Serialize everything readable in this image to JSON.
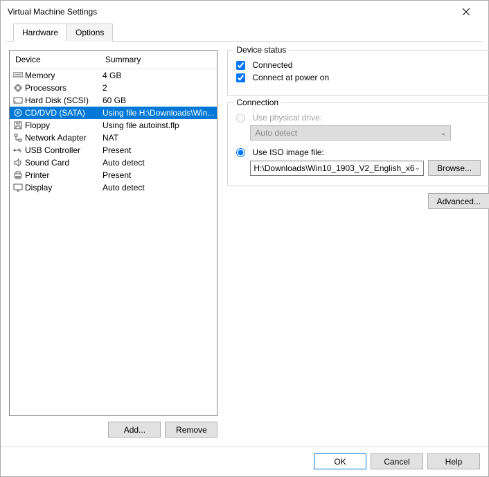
{
  "window": {
    "title": "Virtual Machine Settings"
  },
  "tabs": {
    "hardware": "Hardware",
    "options": "Options"
  },
  "headers": {
    "device": "Device",
    "summary": "Summary"
  },
  "devices": [
    {
      "name": "Memory",
      "summary": "4 GB"
    },
    {
      "name": "Processors",
      "summary": "2"
    },
    {
      "name": "Hard Disk (SCSI)",
      "summary": "60 GB"
    },
    {
      "name": "CD/DVD (SATA)",
      "summary": "Using file H:\\Downloads\\Win..."
    },
    {
      "name": "Floppy",
      "summary": "Using file autoinst.flp"
    },
    {
      "name": "Network Adapter",
      "summary": "NAT"
    },
    {
      "name": "USB Controller",
      "summary": "Present"
    },
    {
      "name": "Sound Card",
      "summary": "Auto detect"
    },
    {
      "name": "Printer",
      "summary": "Present"
    },
    {
      "name": "Display",
      "summary": "Auto detect"
    }
  ],
  "left_buttons": {
    "add": "Add...",
    "remove": "Remove"
  },
  "device_status": {
    "title": "Device status",
    "connected": "Connected",
    "connect_at_power_on": "Connect at power on"
  },
  "connection": {
    "title": "Connection",
    "use_physical_drive": "Use physical drive:",
    "auto_detect": "Auto detect",
    "use_iso": "Use ISO image file:",
    "iso_path": "H:\\Downloads\\Win10_1903_V2_English_x6",
    "browse": "Browse..."
  },
  "advanced": "Advanced...",
  "footer": {
    "ok": "OK",
    "cancel": "Cancel",
    "help": "Help"
  }
}
